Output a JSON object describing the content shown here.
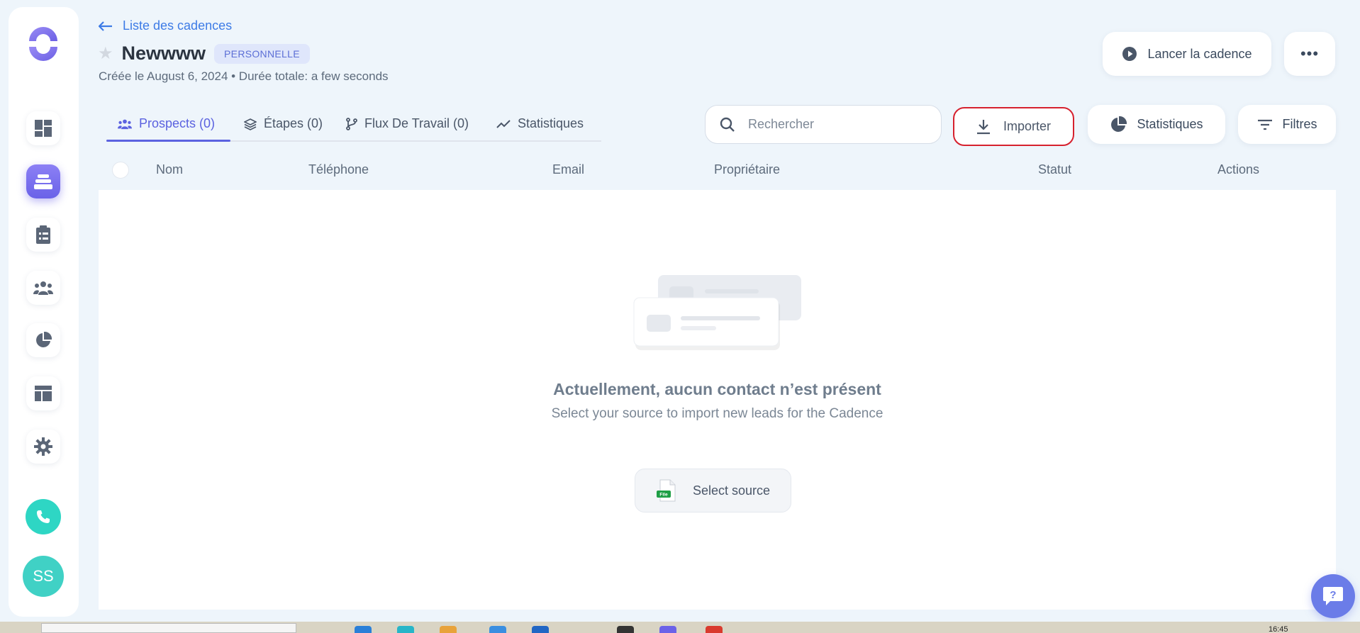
{
  "header": {
    "back_label": "Liste des cadences",
    "title": "Newwww",
    "badge": "PERSONNELLE",
    "created": "Créée le August 6, 2024 • Durée totale: a few seconds",
    "launch_label": "Lancer la cadence",
    "more_label": "•••"
  },
  "tabs": [
    {
      "label": "Prospects (0)",
      "active": true,
      "icon": "users-icon"
    },
    {
      "label": "Étapes (0)",
      "active": false,
      "icon": "layers-icon"
    },
    {
      "label": "Flux De Travail (0)",
      "active": false,
      "icon": "workflow-icon"
    },
    {
      "label": "Statistiques",
      "active": false,
      "icon": "trend-icon"
    }
  ],
  "toolbar": {
    "search_placeholder": "Rechercher",
    "import_label": "Importer",
    "stats_label": "Statistiques",
    "filters_label": "Filtres"
  },
  "table": {
    "columns": [
      "Nom",
      "Téléphone",
      "Email",
      "Propriétaire",
      "Statut",
      "Actions"
    ]
  },
  "empty_state": {
    "title": "Actuellement, aucun contact n’est présent",
    "subtitle": "Select your source to import new leads for the Cadence",
    "button_label": "Select source",
    "file_badge": "File"
  },
  "sidebar": {
    "items": [
      "dashboard-icon",
      "cadence-icon",
      "tasks-icon",
      "people-icon",
      "reports-icon",
      "templates-icon",
      "settings-icon"
    ],
    "active_index": 1,
    "avatar_initials": "SS"
  },
  "taskbar": {
    "time": "16:45"
  },
  "colors": {
    "accent": "#5b62e0",
    "link": "#3d7be6",
    "import_border": "#d6212e",
    "teal": "#2ed6c4"
  }
}
